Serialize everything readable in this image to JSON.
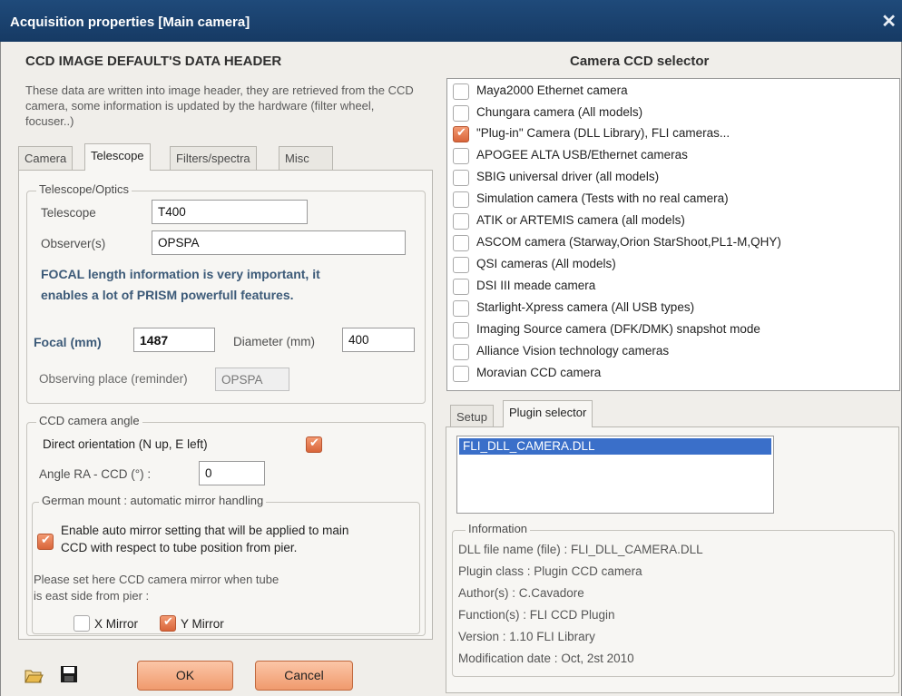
{
  "window": {
    "title": "Acquisition properties [Main camera]",
    "close": "✕"
  },
  "left": {
    "header": "CCD IMAGE DEFAULT'S DATA HEADER",
    "info": "These data are written into image header, they are retrieved from the CCD camera, some information is updated by the hardware (filter wheel, focuser..)",
    "tabs": [
      "Camera",
      "Telescope",
      "Filters/spectra",
      "Misc"
    ],
    "optics": {
      "group_label": "Telescope/Optics",
      "telescope_label": "Telescope",
      "telescope_value": "T400",
      "observer_label": "Observer(s)",
      "observer_value": "OPSPA",
      "note_line1": "FOCAL length information is very important, it",
      "note_line2": "enables a lot of PRISM powerfull features.",
      "focal_label": "Focal (mm)",
      "focal_value": "1487",
      "diameter_label": "Diameter (mm)",
      "diameter_value": "400",
      "place_label": "Observing place (reminder)",
      "place_value": "OPSPA"
    },
    "ccd_angle": {
      "group_label": "CCD camera angle",
      "direct_label": "Direct orientation (N up, E  left)",
      "direct_checked": true,
      "angle_label": "Angle RA - CCD (°) :",
      "angle_value": "0",
      "mount_label": "German mount : automatic mirror handling",
      "auto_mirror_label_1": "Enable auto mirror setting that will be applied to main",
      "auto_mirror_label_2": "CCD with respect to tube position from pier.",
      "auto_mirror_checked": true,
      "east_note_1": "Please set here CCD camera mirror when tube",
      "east_note_2": "is east side from pier :",
      "x_mirror_label": "X Mirror",
      "x_mirror_checked": false,
      "y_mirror_label": "Y Mirror",
      "y_mirror_checked": true
    },
    "buttons": {
      "ok": "OK",
      "cancel": "Cancel"
    }
  },
  "right": {
    "header": "Camera CCD selector",
    "cameras": [
      {
        "label": "Maya2000 Ethernet camera",
        "checked": false
      },
      {
        "label": "Chungara camera (All models)",
        "checked": false
      },
      {
        "label": "\"Plug-in\" Camera (DLL Library), FLI cameras...",
        "checked": true
      },
      {
        "label": "APOGEE ALTA USB/Ethernet cameras",
        "checked": false
      },
      {
        "label": "SBIG universal driver (all models)",
        "checked": false
      },
      {
        "label": "Simulation camera (Tests with no real camera)",
        "checked": false
      },
      {
        "label": "ATIK or ARTEMIS camera (all models)",
        "checked": false
      },
      {
        "label": "ASCOM camera (Starway,Orion StarShoot,PL1-M,QHY)",
        "checked": false
      },
      {
        "label": "QSI cameras (All models)",
        "checked": false
      },
      {
        "label": "DSI III meade camera",
        "checked": false
      },
      {
        "label": "Starlight-Xpress camera (All USB types)",
        "checked": false
      },
      {
        "label": "Imaging Source camera (DFK/DMK) snapshot mode",
        "checked": false
      },
      {
        "label": "Alliance Vision technology cameras",
        "checked": false
      },
      {
        "label": "Moravian CCD camera",
        "checked": false
      }
    ],
    "tabs": [
      "Setup",
      "Plugin selector"
    ],
    "plugins": [
      "FLI_DLL_CAMERA.DLL"
    ],
    "information": {
      "group_label": "Information",
      "lines": [
        "DLL file name (file) : FLI_DLL_CAMERA.DLL",
        "Plugin class : Plugin CCD camera",
        "Author(s) : C.Cavadore",
        "Function(s) : FLI CCD Plugin",
        "Version : 1.10 FLI Library",
        "Modification date : Oct, 2st 2010"
      ]
    }
  }
}
